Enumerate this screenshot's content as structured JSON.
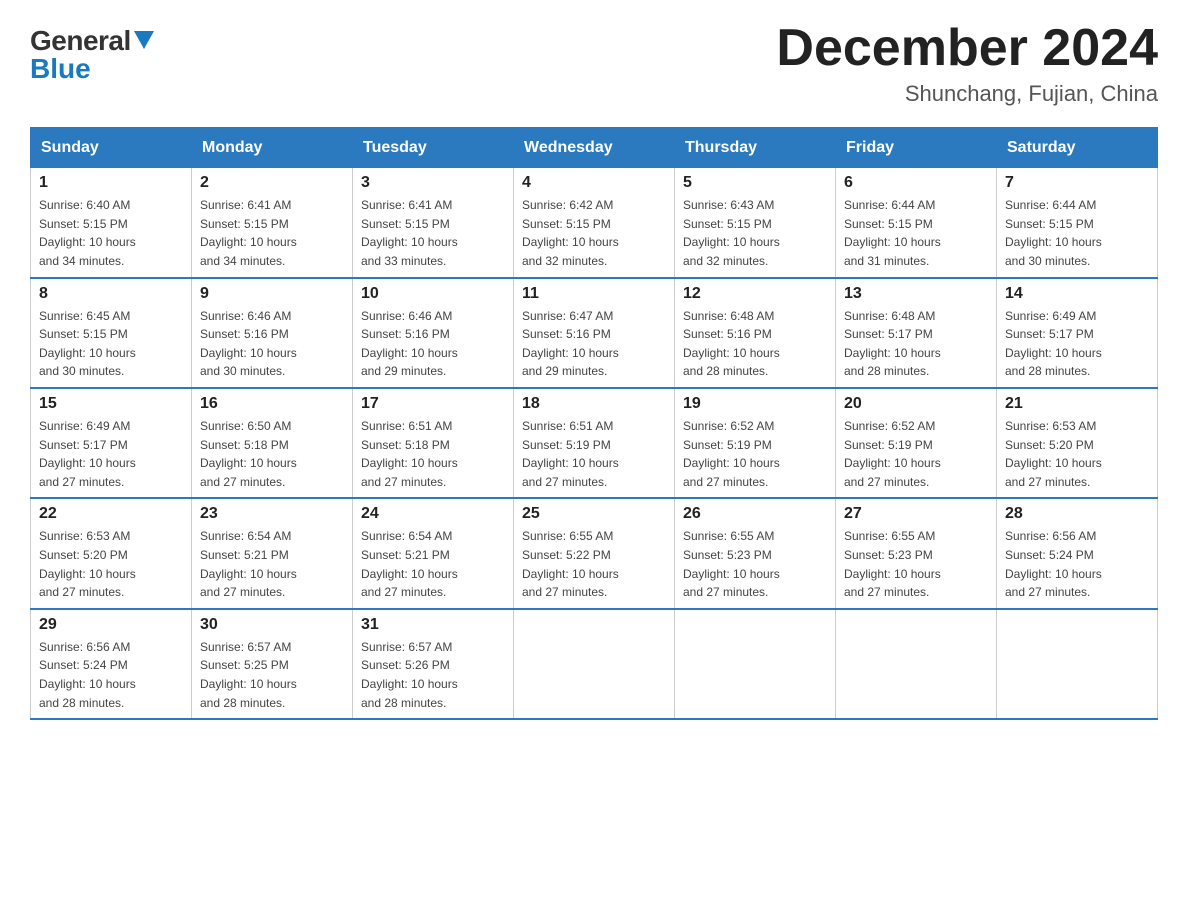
{
  "header": {
    "logo_general": "General",
    "logo_blue": "Blue",
    "title": "December 2024",
    "location": "Shunchang, Fujian, China"
  },
  "days_of_week": [
    "Sunday",
    "Monday",
    "Tuesday",
    "Wednesday",
    "Thursday",
    "Friday",
    "Saturday"
  ],
  "weeks": [
    [
      {
        "day": "1",
        "sunrise": "6:40 AM",
        "sunset": "5:15 PM",
        "daylight": "10 hours and 34 minutes."
      },
      {
        "day": "2",
        "sunrise": "6:41 AM",
        "sunset": "5:15 PM",
        "daylight": "10 hours and 34 minutes."
      },
      {
        "day": "3",
        "sunrise": "6:41 AM",
        "sunset": "5:15 PM",
        "daylight": "10 hours and 33 minutes."
      },
      {
        "day": "4",
        "sunrise": "6:42 AM",
        "sunset": "5:15 PM",
        "daylight": "10 hours and 32 minutes."
      },
      {
        "day": "5",
        "sunrise": "6:43 AM",
        "sunset": "5:15 PM",
        "daylight": "10 hours and 32 minutes."
      },
      {
        "day": "6",
        "sunrise": "6:44 AM",
        "sunset": "5:15 PM",
        "daylight": "10 hours and 31 minutes."
      },
      {
        "day": "7",
        "sunrise": "6:44 AM",
        "sunset": "5:15 PM",
        "daylight": "10 hours and 30 minutes."
      }
    ],
    [
      {
        "day": "8",
        "sunrise": "6:45 AM",
        "sunset": "5:15 PM",
        "daylight": "10 hours and 30 minutes."
      },
      {
        "day": "9",
        "sunrise": "6:46 AM",
        "sunset": "5:16 PM",
        "daylight": "10 hours and 30 minutes."
      },
      {
        "day": "10",
        "sunrise": "6:46 AM",
        "sunset": "5:16 PM",
        "daylight": "10 hours and 29 minutes."
      },
      {
        "day": "11",
        "sunrise": "6:47 AM",
        "sunset": "5:16 PM",
        "daylight": "10 hours and 29 minutes."
      },
      {
        "day": "12",
        "sunrise": "6:48 AM",
        "sunset": "5:16 PM",
        "daylight": "10 hours and 28 minutes."
      },
      {
        "day": "13",
        "sunrise": "6:48 AM",
        "sunset": "5:17 PM",
        "daylight": "10 hours and 28 minutes."
      },
      {
        "day": "14",
        "sunrise": "6:49 AM",
        "sunset": "5:17 PM",
        "daylight": "10 hours and 28 minutes."
      }
    ],
    [
      {
        "day": "15",
        "sunrise": "6:49 AM",
        "sunset": "5:17 PM",
        "daylight": "10 hours and 27 minutes."
      },
      {
        "day": "16",
        "sunrise": "6:50 AM",
        "sunset": "5:18 PM",
        "daylight": "10 hours and 27 minutes."
      },
      {
        "day": "17",
        "sunrise": "6:51 AM",
        "sunset": "5:18 PM",
        "daylight": "10 hours and 27 minutes."
      },
      {
        "day": "18",
        "sunrise": "6:51 AM",
        "sunset": "5:19 PM",
        "daylight": "10 hours and 27 minutes."
      },
      {
        "day": "19",
        "sunrise": "6:52 AM",
        "sunset": "5:19 PM",
        "daylight": "10 hours and 27 minutes."
      },
      {
        "day": "20",
        "sunrise": "6:52 AM",
        "sunset": "5:19 PM",
        "daylight": "10 hours and 27 minutes."
      },
      {
        "day": "21",
        "sunrise": "6:53 AM",
        "sunset": "5:20 PM",
        "daylight": "10 hours and 27 minutes."
      }
    ],
    [
      {
        "day": "22",
        "sunrise": "6:53 AM",
        "sunset": "5:20 PM",
        "daylight": "10 hours and 27 minutes."
      },
      {
        "day": "23",
        "sunrise": "6:54 AM",
        "sunset": "5:21 PM",
        "daylight": "10 hours and 27 minutes."
      },
      {
        "day": "24",
        "sunrise": "6:54 AM",
        "sunset": "5:21 PM",
        "daylight": "10 hours and 27 minutes."
      },
      {
        "day": "25",
        "sunrise": "6:55 AM",
        "sunset": "5:22 PM",
        "daylight": "10 hours and 27 minutes."
      },
      {
        "day": "26",
        "sunrise": "6:55 AM",
        "sunset": "5:23 PM",
        "daylight": "10 hours and 27 minutes."
      },
      {
        "day": "27",
        "sunrise": "6:55 AM",
        "sunset": "5:23 PM",
        "daylight": "10 hours and 27 minutes."
      },
      {
        "day": "28",
        "sunrise": "6:56 AM",
        "sunset": "5:24 PM",
        "daylight": "10 hours and 27 minutes."
      }
    ],
    [
      {
        "day": "29",
        "sunrise": "6:56 AM",
        "sunset": "5:24 PM",
        "daylight": "10 hours and 28 minutes."
      },
      {
        "day": "30",
        "sunrise": "6:57 AM",
        "sunset": "5:25 PM",
        "daylight": "10 hours and 28 minutes."
      },
      {
        "day": "31",
        "sunrise": "6:57 AM",
        "sunset": "5:26 PM",
        "daylight": "10 hours and 28 minutes."
      },
      null,
      null,
      null,
      null
    ]
  ]
}
